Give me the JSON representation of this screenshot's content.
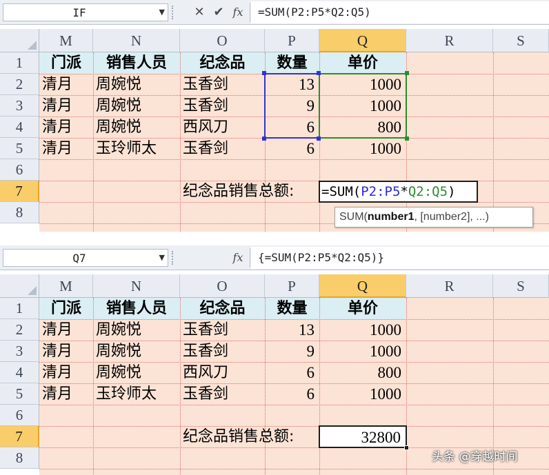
{
  "columns": [
    "M",
    "N",
    "O",
    "P",
    "Q",
    "R",
    "S"
  ],
  "rows": [
    "1",
    "2",
    "3",
    "4",
    "5",
    "6",
    "7",
    "8"
  ],
  "table": {
    "headers": [
      "门派",
      "销售人员",
      "纪念品",
      "数量",
      "单价"
    ],
    "data": [
      [
        "清月",
        "周婉悦",
        "玉香剑",
        "13",
        "1000"
      ],
      [
        "清月",
        "周婉悦",
        "玉香剑",
        "9",
        "1000"
      ],
      [
        "清月",
        "周婉悦",
        "西风刀",
        "6",
        "800"
      ],
      [
        "清月",
        "玉玲师太",
        "玉香剑",
        "6",
        "1000"
      ]
    ]
  },
  "total_label": "纪念品销售总额:",
  "panel1": {
    "name_box": "IF",
    "formula": "=SUM(P2:P5*Q2:Q5)",
    "edit": {
      "prefix": "=SUM(",
      "range1": "P2:P5",
      "op": "*",
      "range2": "Q2:Q5",
      "suffix": ")"
    },
    "tooltip": {
      "fn": "SUM(",
      "arg1": "number1",
      "rest": ", [number2], ...)"
    }
  },
  "panel2": {
    "name_box": "Q7",
    "formula": "{=SUM(P2:P5*Q2:Q5)}",
    "result": "32800"
  },
  "icons": {
    "cancel": "✕",
    "enter": "✔",
    "fx": "fx"
  },
  "watermark": "头条 @穿越时间",
  "colors": {
    "header_band": "#daeef3",
    "cell_fill": "#fbe3d5",
    "selected_header": "#f8cd6a",
    "range_blue": "#3333cc",
    "range_green": "#2e8b2e"
  }
}
